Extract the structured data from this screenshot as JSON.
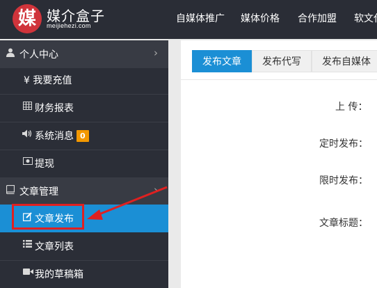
{
  "brand": {
    "logo_char": "媒",
    "name": "媒介盒子",
    "domain": "meijiehezi.com",
    "logo_color": "#d0343b"
  },
  "top_nav": [
    "自媒体推广",
    "媒体价格",
    "合作加盟",
    "软文代"
  ],
  "sidebar": {
    "user_center": {
      "label": "个人中心",
      "icon": "user-icon"
    },
    "recharge": {
      "icon_char": "¥",
      "label": "我要充值"
    },
    "finance": {
      "label": "财务报表",
      "icon": "table-icon"
    },
    "messages": {
      "label": "系统消息",
      "badge": "0",
      "icon": "volume-icon"
    },
    "withdraw": {
      "label": "提现",
      "icon": "money-icon"
    },
    "article_mgmt": {
      "label": "文章管理",
      "icon": "book-icon"
    },
    "article_publish": {
      "label": "文章发布",
      "icon": "edit-icon"
    },
    "article_list": {
      "label": "文章列表",
      "icon": "list-icon"
    },
    "drafts": {
      "label": "我的草稿箱",
      "icon": "video-icon"
    }
  },
  "tabs": [
    "发布文章",
    "发布代写",
    "发布自媒体"
  ],
  "form": {
    "upload_label": "上 传：",
    "scheduled_label": "定时发布：",
    "limited_label": "限时发布：",
    "title_label": "文章标题："
  },
  "colors": {
    "topbar": "#2a2d36",
    "sidebar": "#2b2e37",
    "active": "#1b8fd5",
    "badge": "#f39800",
    "annotation": "#e02020"
  }
}
